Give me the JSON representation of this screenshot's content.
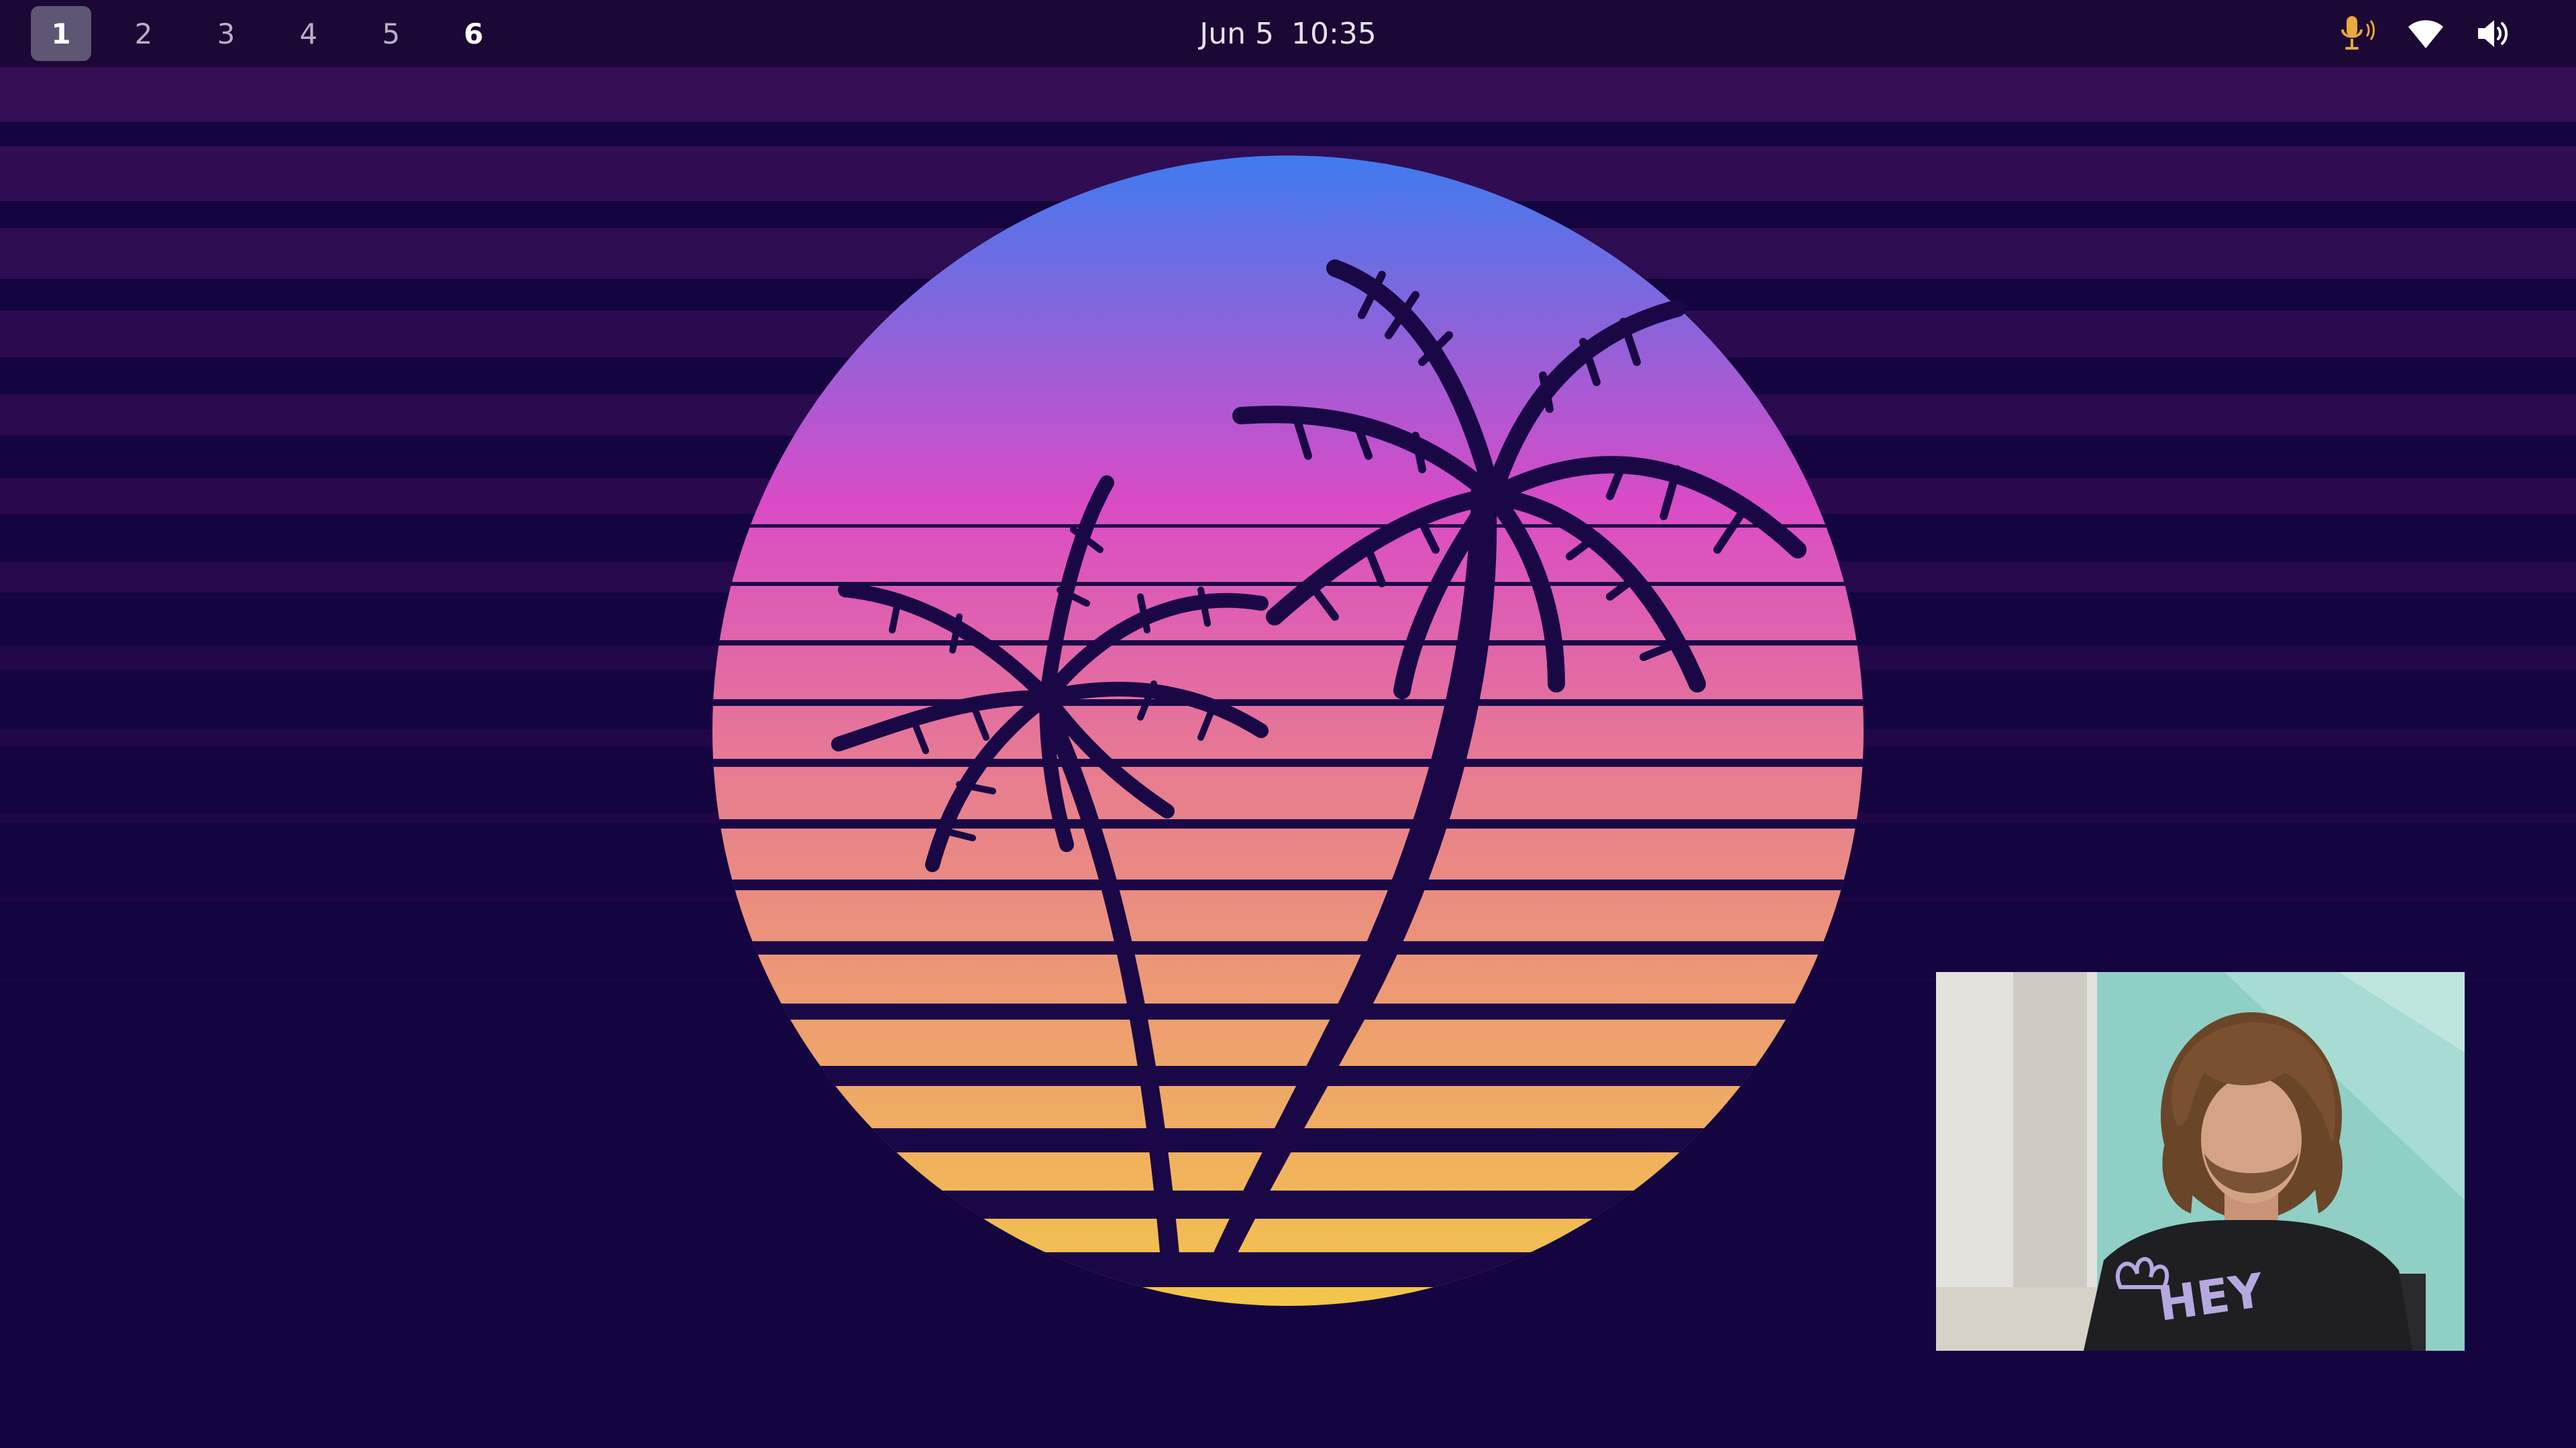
{
  "workspaces": [
    {
      "label": "1",
      "state": "active"
    },
    {
      "label": "2",
      "state": "empty"
    },
    {
      "label": "3",
      "state": "empty"
    },
    {
      "label": "4",
      "state": "empty"
    },
    {
      "label": "5",
      "state": "empty"
    },
    {
      "label": "6",
      "state": "occupied"
    }
  ],
  "clock": {
    "date": "Jun 5",
    "time": "10:35"
  },
  "tray": {
    "microphone_icon": "microphone-active-icon",
    "wifi_icon": "wifi-icon",
    "volume_icon": "volume-icon",
    "mic_color": "#e9a93c"
  },
  "colors": {
    "background": "#14043f",
    "topbar": "#1b0834",
    "sun_top": "#3f7bef",
    "sun_mid": "#d94bc7",
    "sun_bottom": "#f3c64a",
    "palm": "#1a0746"
  },
  "webcam": {
    "shirt_text": "HEY"
  }
}
